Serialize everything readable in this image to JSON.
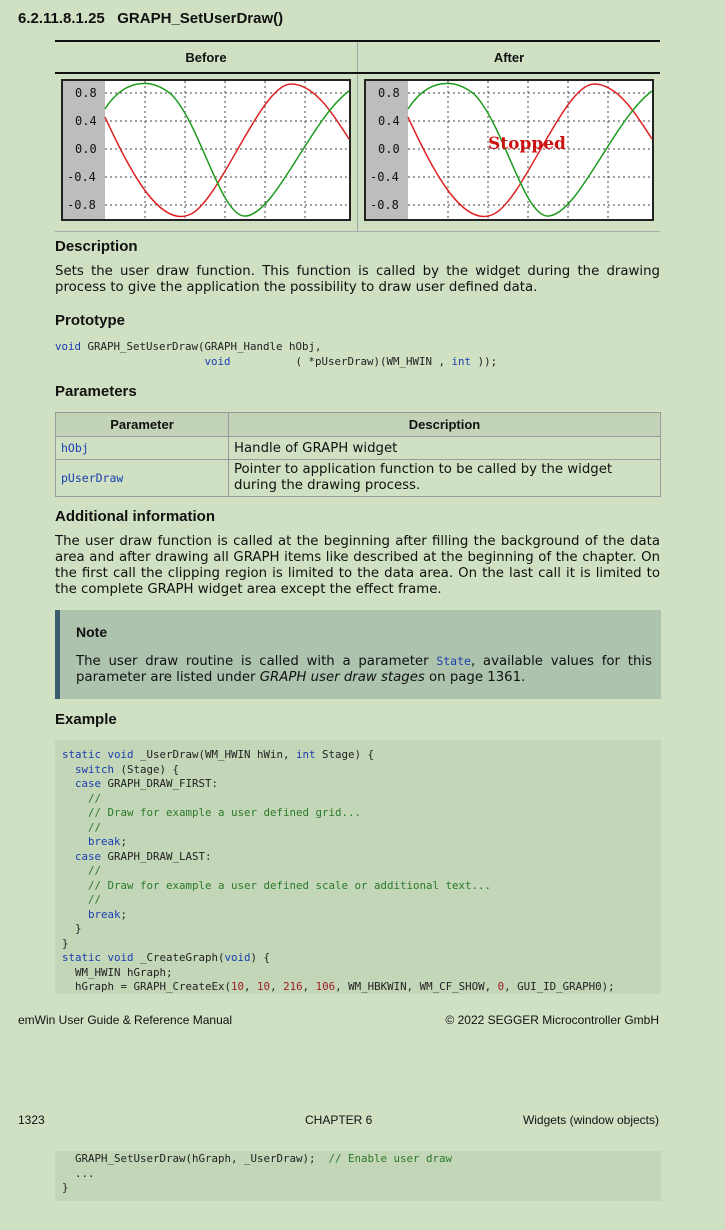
{
  "section": {
    "number": "6.2.11.8.1.25",
    "name": "GRAPH_SetUserDraw()"
  },
  "figure": {
    "col_before": "Before",
    "col_after": "After",
    "y_ticks": [
      "0.8",
      "0.4",
      "0.0",
      "-0.4",
      "-0.8"
    ],
    "stopped_label": "Stopped",
    "colors": {
      "graph_bg": "#ffffff",
      "scale_bg": "#c0c0c0",
      "red": "#e02020",
      "green": "#1e9a1e",
      "stopped": "#cc1111"
    }
  },
  "description": {
    "heading": "Description",
    "text": "Sets the user draw function. This function is called by the widget during the drawing process to give the application the possibility to draw user defined data."
  },
  "prototype": {
    "heading": "Prototype",
    "line1_kw": "void",
    "line1_rest": " GRAPH_SetUserDraw(GRAPH_Handle hObj,",
    "line2_indent": "                       ",
    "line2_kw": "void",
    "line2_mid": "          ( *pUserDraw)(WM_HWIN , ",
    "line2_kw2": "int",
    "line2_end": " ));"
  },
  "parameters": {
    "heading": "Parameters",
    "col_param": "Parameter",
    "col_desc": "Description",
    "rows": [
      {
        "name": "hObj",
        "desc": "Handle of GRAPH widget"
      },
      {
        "name": "pUserDraw",
        "desc": "Pointer to application function to be called by the widget during the drawing process."
      }
    ]
  },
  "additional": {
    "heading": "Additional information",
    "text": "The user draw function is called at the beginning after filling the background of the data area and after drawing all GRAPH items like described at the beginning of the chapter. On the first call the clipping region is limited to the data area. On the last call it is limited to the complete GRAPH widget area except the effect frame."
  },
  "note": {
    "title": "Note",
    "text_before": "The user draw routine is called with a parameter ",
    "code": "State",
    "text_mid": ", available values for this parameter are listed under ",
    "italic": "GRAPH user draw stages",
    "text_after": " on page 1361."
  },
  "example": {
    "heading": "Example"
  },
  "footer": {
    "left": "emWin User Guide & Reference Manual",
    "right": "© 2022 SEGGER Microcontroller GmbH"
  },
  "header2": {
    "page": "1323",
    "chapter": "CHAPTER 6",
    "title": "Widgets (window objects)"
  }
}
